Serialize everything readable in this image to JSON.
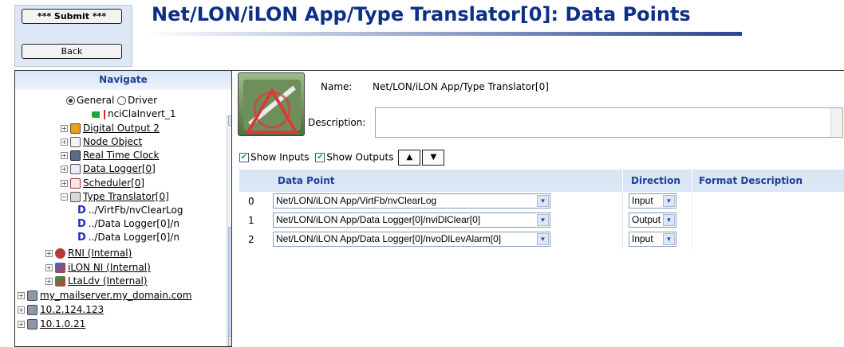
{
  "header": {
    "submit_label": "*** Submit ***",
    "back_label": "Back",
    "title": "Net/LON/iLON App/Type Translator[0]: Data Points"
  },
  "nav": {
    "heading": "Navigate",
    "radio_general": "General",
    "radio_driver": "Driver",
    "selected_radio": "General",
    "items": [
      {
        "label": "nciClaInvert_1",
        "icon": "green-arrow-icon"
      },
      {
        "label": "Digital Output 2",
        "icon": "digital-output-icon"
      },
      {
        "label": "Node Object",
        "icon": "node-object-icon"
      },
      {
        "label": "Real Time Clock",
        "icon": "clock-icon"
      },
      {
        "label": "Data Logger[0]",
        "icon": "data-logger-icon"
      },
      {
        "label": "Scheduler[0]",
        "icon": "scheduler-icon"
      },
      {
        "label": "Type Translator[0]",
        "icon": "translator-icon"
      },
      {
        "label": "../VirtFb/nvClearLog",
        "icon": "datapoint-icon"
      },
      {
        "label": "../Data Logger[0]/n",
        "icon": "datapoint-icon"
      },
      {
        "label": "../Data Logger[0]/n",
        "icon": "datapoint-icon"
      },
      {
        "label": "RNI (Internal)",
        "icon": "rni-icon"
      },
      {
        "label": "iLON NI (Internal)",
        "icon": "network-icon"
      },
      {
        "label": "LtaLdv (Internal)",
        "icon": "network-icon"
      },
      {
        "label": "my_mailserver.my_domain.com",
        "icon": "computer-icon"
      },
      {
        "label": "10.2.124.123",
        "icon": "computer-icon"
      },
      {
        "label": "10.1.0.21",
        "icon": "computer-icon"
      }
    ]
  },
  "main": {
    "name_label": "Name:",
    "name_value": "Net/LON/iLON App/Type Translator[0]",
    "description_label": "Description:",
    "description_value": "",
    "show_inputs_label": "Show Inputs",
    "show_outputs_label": "Show Outputs",
    "show_inputs_checked": true,
    "show_outputs_checked": true,
    "up_label": "▲",
    "down_label": "▼",
    "columns": [
      "Data Point",
      "Direction",
      "Format Description"
    ],
    "rows": [
      {
        "index": "0",
        "data_point": "Net/LON/iLON App/VirtFb/nvClearLog",
        "direction": "Input",
        "format": ""
      },
      {
        "index": "1",
        "data_point": "Net/LON/iLON App/Data Logger[0]/nviDlClear[0]",
        "direction": "Output",
        "format": ""
      },
      {
        "index": "2",
        "data_point": "Net/LON/iLON App/Data Logger[0]/nvoDlLevAlarm[0]",
        "direction": "Input",
        "format": ""
      }
    ]
  },
  "colors": {
    "title_blue": "#0d2f88",
    "header_blue": "#1f3f99",
    "table_header_bg": "#dbe6f5"
  }
}
